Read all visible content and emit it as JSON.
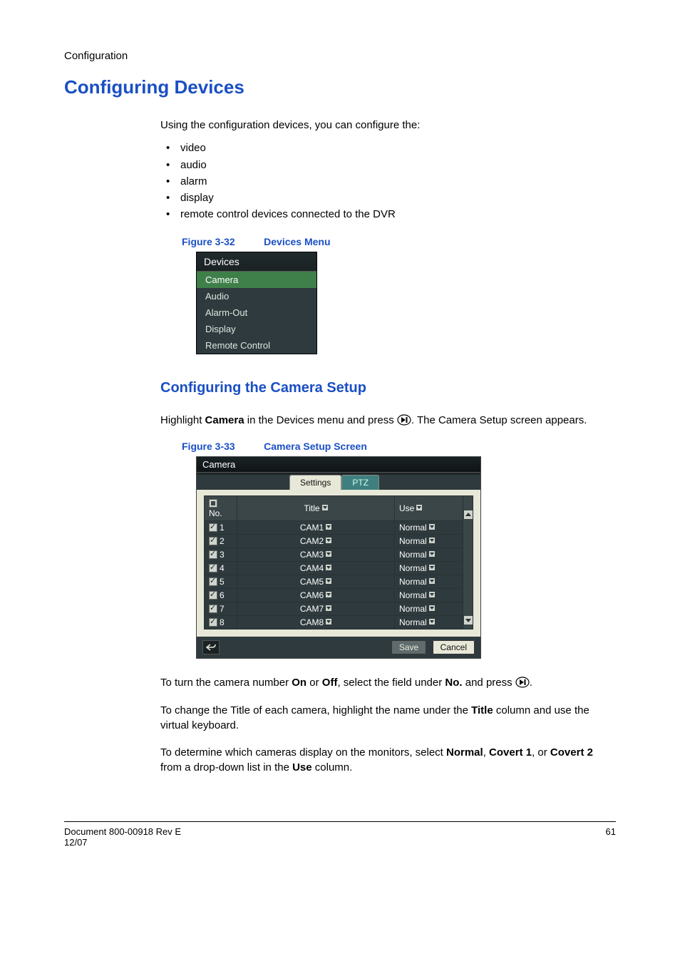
{
  "breadcrumb": "Configuration",
  "h1": "Configuring Devices",
  "intro": "Using the configuration devices, you can configure the:",
  "bullets": [
    "video",
    "audio",
    "alarm",
    "display",
    "remote control devices connected to the DVR"
  ],
  "fig1": {
    "no": "Figure 3-32",
    "title": "Devices Menu"
  },
  "devices_menu": {
    "title": "Devices",
    "items": [
      "Camera",
      "Audio",
      "Alarm-Out",
      "Display",
      "Remote Control"
    ]
  },
  "h2": "Configuring the Camera Setup",
  "para1_a": "Highlight ",
  "para1_b": "Camera",
  "para1_c": " in the Devices menu and press ",
  "para1_d": ". The Camera Setup screen appears.",
  "fig2": {
    "no": "Figure 3-33",
    "title": "Camera Setup Screen"
  },
  "camera_screen": {
    "title": "Camera",
    "tabs": {
      "active": "Settings",
      "inactive": "PTZ"
    },
    "headers": {
      "no": "No.",
      "title": "Title",
      "use": "Use"
    },
    "rows": [
      {
        "num": "1",
        "title": "CAM1",
        "use": "Normal"
      },
      {
        "num": "2",
        "title": "CAM2",
        "use": "Normal"
      },
      {
        "num": "3",
        "title": "CAM3",
        "use": "Normal"
      },
      {
        "num": "4",
        "title": "CAM4",
        "use": "Normal"
      },
      {
        "num": "5",
        "title": "CAM5",
        "use": "Normal"
      },
      {
        "num": "6",
        "title": "CAM6",
        "use": "Normal"
      },
      {
        "num": "7",
        "title": "CAM7",
        "use": "Normal"
      },
      {
        "num": "8",
        "title": "CAM8",
        "use": "Normal"
      }
    ],
    "buttons": {
      "save": "Save",
      "cancel": "Cancel"
    }
  },
  "para2_a": "To turn the camera number ",
  "para2_b": "On",
  "para2_c": " or ",
  "para2_d": "Off",
  "para2_e": ", select the field under ",
  "para2_f": "No.",
  "para2_g": " and press ",
  "para2_h": ".",
  "para3_a": "To change the Title of each camera, highlight the name under the ",
  "para3_b": "Title",
  "para3_c": " column and use the virtual keyboard.",
  "para4_a": "To determine which cameras display on the monitors, select ",
  "para4_b": "Normal",
  "para4_c": ", ",
  "para4_d": "Covert 1",
  "para4_e": ", or ",
  "para4_f": "Covert 2",
  "para4_g": " from a drop-down list in the ",
  "para4_h": "Use",
  "para4_i": " column.",
  "footer": {
    "doc": "Document 800-00918 Rev E",
    "date": "12/07",
    "page": "61"
  }
}
